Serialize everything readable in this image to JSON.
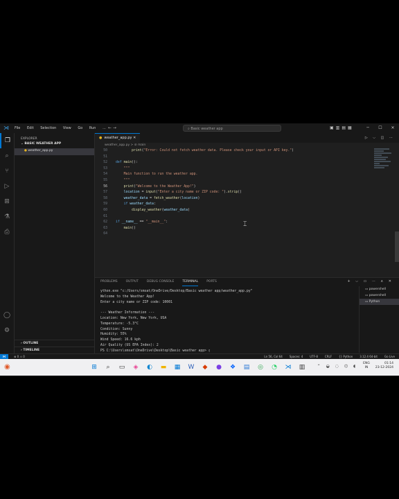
{
  "titlebar": {
    "menu": [
      "File",
      "Edit",
      "Selection",
      "View",
      "Go",
      "Run",
      "..."
    ],
    "search": "Basic weather app"
  },
  "sidebar": {
    "header": "EXPLORER",
    "folder": "BASIC WEATHER APP",
    "file": "weather_app.py",
    "outline": "OUTLINE",
    "timeline": "TIMELINE"
  },
  "editor": {
    "tab": "weather_app.py",
    "breadcrumb": "weather_app.py > ⊘ main",
    "lines": [
      {
        "n": "50",
        "html": "        <span class='fn'>print</span><span class='tx'>(</span><span class='st'>\"Error: Could not fetch weather data. Please check your input or API key.\"</span><span class='tx'>)</span>"
      },
      {
        "n": "51",
        "html": ""
      },
      {
        "n": "52",
        "html": "<span class='kw'>def</span> <span class='fn'>main</span><span class='tx'>():</span>"
      },
      {
        "n": "53",
        "html": "    <span class='st'>\"\"\"</span>"
      },
      {
        "n": "54",
        "html": "    <span class='st'>Main function to run the weather app.</span>"
      },
      {
        "n": "55",
        "html": "    <span class='st'>\"\"\"</span>"
      },
      {
        "n": "56",
        "html": "    <span class='fn'>print</span><span class='tx'>(</span><span class='st'>\"Welcome to the Weather App!\"</span><span class='tx'>)</span>"
      },
      {
        "n": "57",
        "html": "    <span class='va'>location</span> <span class='tx'>=</span> <span class='fn'>input</span><span class='tx'>(</span><span class='st'>\"Enter a city name or ZIP code: \"</span><span class='tx'>).</span><span class='fn'>strip</span><span class='tx'>()</span>"
      },
      {
        "n": "58",
        "html": "    <span class='va'>weather_data</span> <span class='tx'>=</span> <span class='fn'>fetch_weather</span><span class='tx'>(</span><span class='va'>location</span><span class='tx'>)</span>"
      },
      {
        "n": "59",
        "html": "    <span class='kw'>if</span> <span class='va'>weather_data</span><span class='tx'>:</span>"
      },
      {
        "n": "60",
        "html": "        <span class='fn'>display_weather</span><span class='tx'>(</span><span class='va'>weather_data</span><span class='tx'>)</span>"
      },
      {
        "n": "61",
        "html": ""
      },
      {
        "n": "62",
        "html": "<span class='kw'>if</span> <span class='va'>__name__</span> <span class='tx'>==</span> <span class='st'>\"__main__\"</span><span class='tx'>:</span>"
      },
      {
        "n": "63",
        "html": "    <span class='fn'>main</span><span class='tx'>()</span>"
      },
      {
        "n": "64",
        "html": ""
      }
    ]
  },
  "panel": {
    "tabs": [
      "PROBLEMS",
      "OUTPUT",
      "DEBUG CONSOLE",
      "TERMINAL",
      "PORTS"
    ],
    "active_tab": "TERMINAL",
    "terminal_lines": [
      "ython.exe \"c:/Users/smsat/OneDrive/Desktop/Basic weather app/weather_app.py\"",
      "Welcome to the Weather App!",
      "Enter a city name or ZIP code: 10001",
      "",
      "--- Weather Information ---",
      "Location: New York, New York, USA",
      "Temperature: -5.3°C",
      "Condition: Sunny",
      "Humidity: 55%",
      "Wind Speed: 16.6 kph",
      "Air Quality (US EPA Index): 2",
      "PS C:\\Users\\smsat\\OneDrive\\Desktop\\Basic weather app> ▯"
    ],
    "terminals": [
      "powershell",
      "powershell",
      "Python"
    ]
  },
  "statusbar": {
    "left": "⊗ 0 ⚠ 0",
    "right": [
      "Ln 56, Col 64",
      "Spaces: 4",
      "UTF-8",
      "CRLF",
      "{} Python",
      "3.12.4 64-bit",
      "Go Live"
    ]
  },
  "taskbar": {
    "lang": [
      "ENG",
      "IN"
    ],
    "time": "01:14",
    "date": "23-12-2024"
  },
  "colors": {
    "accent": "#0078d4",
    "editor_bg": "#1f1f1f",
    "taskbar": "#f0f0f2"
  }
}
